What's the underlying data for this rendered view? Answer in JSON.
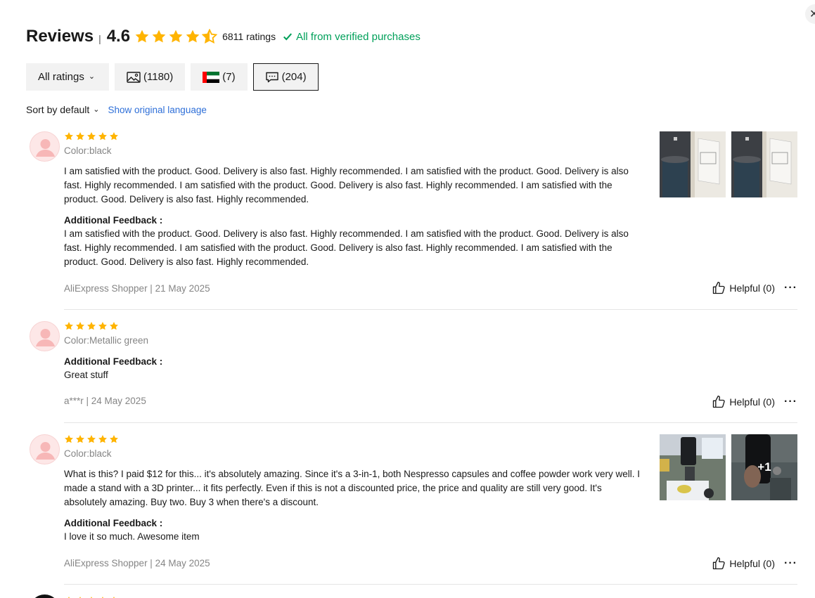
{
  "header": {
    "title": "Reviews",
    "separator": "|",
    "score": "4.6",
    "ratings_count": "6811 ratings",
    "verified_text": "All from verified purchases"
  },
  "filters": {
    "all_ratings": "All ratings",
    "photos_count": "(1180)",
    "country_count": "(7)",
    "comments_count": "(204)"
  },
  "sort": {
    "label": "Sort by default",
    "show_original": "Show original language"
  },
  "colors": {
    "star": "#ffb400",
    "verified": "#00a05a",
    "link": "#2e6fd8",
    "muted": "#858585"
  },
  "reviews": [
    {
      "stars": 5,
      "color": "Color:black",
      "text": "I am satisfied with the product. Good. Delivery is also fast. Highly recommended. I am satisfied with the product. Good. Delivery is also fast. Highly recommended. I am satisfied with the product. Good. Delivery is also fast. Highly recommended. I am satisfied with the product. Good. Delivery is also fast. Highly recommended.",
      "feedback_label": "Additional Feedback :",
      "feedback_text": "I am satisfied with the product. Good. Delivery is also fast. Highly recommended. I am satisfied with the product. Good. Delivery is also fast. Highly recommended. I am satisfied with the product. Good. Delivery is also fast. Highly recommended. I am satisfied with the product. Good. Delivery is also fast. Highly recommended.",
      "meta": "AliExpress Shopper | 21 May 2025",
      "helpful": "Helpful (0)",
      "more": "···"
    },
    {
      "stars": 5,
      "color": "Color:Metallic green",
      "feedback_label": "Additional Feedback :",
      "feedback_text": "Great stuff",
      "meta": "a***r | 24 May 2025",
      "helpful": "Helpful (0)",
      "more": "···"
    },
    {
      "stars": 5,
      "color": "Color:black",
      "text": "What is this? I paid $12 for this... it's absolutely amazing. Since it's a 3-in-1, both Nespresso capsules and coffee powder work very well. I made a stand with a 3D printer... it fits perfectly. Even if this is not a discounted price, the price and quality are still very good. It's absolutely amazing. Buy two. Buy 3 when there's a discount.",
      "feedback_label": "Additional Feedback :",
      "feedback_text": "I love it so much. Awesome item",
      "meta": "AliExpress Shopper | 24 May 2025",
      "helpful": "Helpful (0)",
      "more": "···",
      "extra_photos": "+1"
    }
  ]
}
